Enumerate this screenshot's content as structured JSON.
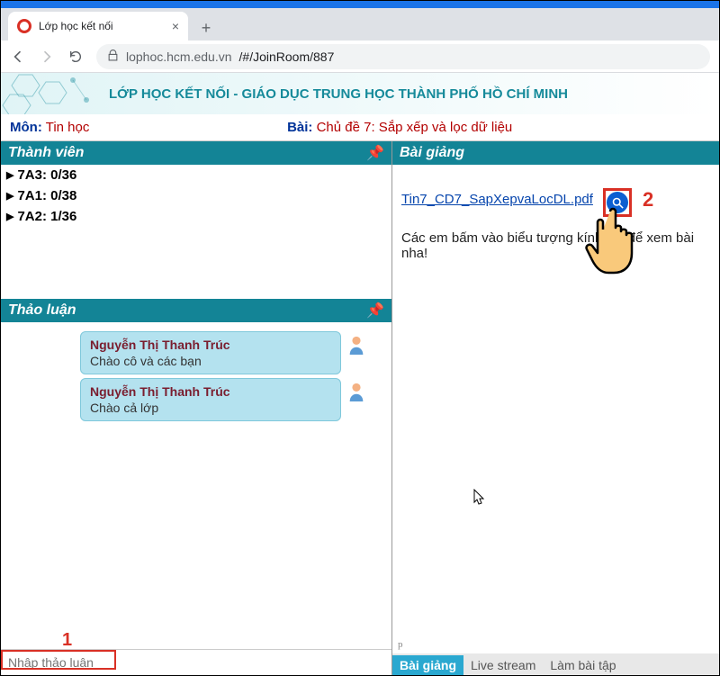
{
  "browser": {
    "tab_title": "Lớp học kết nối",
    "url_host": "lophoc.hcm.edu.vn",
    "url_path": "/#/JoinRoom/887"
  },
  "header": {
    "title": "LỚP HỌC KẾT NỐI  -  GIÁO DỤC TRUNG HỌC THÀNH PHỐ HỒ CHÍ MINH"
  },
  "info": {
    "subject_label": "Môn:",
    "subject_value": "Tin học",
    "lesson_label": "Bài:",
    "lesson_value": "Chủ đề 7: Sắp xếp và lọc dữ liệu"
  },
  "panels": {
    "members_title": "Thành viên",
    "discussion_title": "Thảo luận",
    "lecture_title": "Bài giảng"
  },
  "members": [
    {
      "label": "7A3: 0/36"
    },
    {
      "label": "7A1: 0/38"
    },
    {
      "label": "7A2: 1/36"
    }
  ],
  "messages": [
    {
      "name": "Nguyễn Thị Thanh Trúc",
      "text": "Chào cô và các bạn"
    },
    {
      "name": "Nguyễn Thị Thanh Trúc",
      "text": "Chào cả lớp"
    }
  ],
  "input": {
    "placeholder": "Nhập thảo luận"
  },
  "lecture": {
    "pdf_link": "Tin7_CD7_SapXepvaLocDL.pdf",
    "text": "Các em bấm vào biểu tượng kính lúp để xem bài nha!"
  },
  "annotations": {
    "one": "1",
    "two": "2"
  },
  "tabs": {
    "lecture": "Bài giảng",
    "stream": "Live stream",
    "exercise": "Làm bài tập"
  },
  "misc": {
    "p": "p"
  }
}
